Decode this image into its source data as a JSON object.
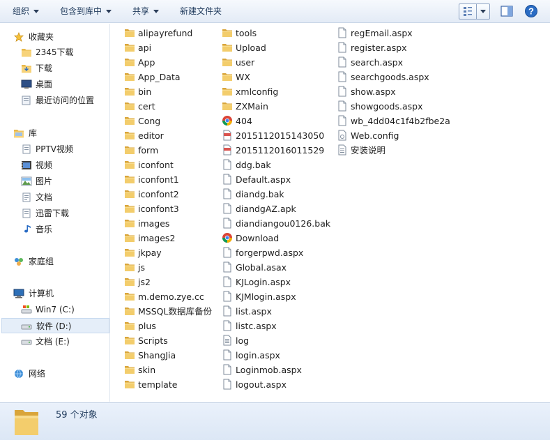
{
  "toolbar": {
    "organize": "组织",
    "include_in_library": "包含到库中",
    "share": "共享",
    "new_folder": "新建文件夹"
  },
  "nav": {
    "favorites": "收藏夹",
    "fav_2345": "2345下载",
    "fav_downloads": "下载",
    "fav_desktop": "桌面",
    "fav_recent": "最近访问的位置",
    "libraries": "库",
    "lib_pptv": "PPTV视频",
    "lib_videos": "视频",
    "lib_pictures": "图片",
    "lib_documents": "文档",
    "lib_xunlei": "迅雷下载",
    "lib_music": "音乐",
    "homegroup": "家庭组",
    "computer": "计算机",
    "drive_c": "Win7 (C:)",
    "drive_d": "软件 (D:)",
    "drive_e": "文档 (E:)",
    "network": "网络"
  },
  "files": [
    {
      "name": "alipayrefund",
      "type": "folder"
    },
    {
      "name": "api",
      "type": "folder"
    },
    {
      "name": "App",
      "type": "folder"
    },
    {
      "name": "App_Data",
      "type": "folder"
    },
    {
      "name": "bin",
      "type": "folder"
    },
    {
      "name": "cert",
      "type": "folder"
    },
    {
      "name": "Cong",
      "type": "folder"
    },
    {
      "name": "editor",
      "type": "folder"
    },
    {
      "name": "form",
      "type": "folder"
    },
    {
      "name": "iconfont",
      "type": "folder"
    },
    {
      "name": "iconfont1",
      "type": "folder"
    },
    {
      "name": "iconfont2",
      "type": "folder"
    },
    {
      "name": "iconfont3",
      "type": "folder"
    },
    {
      "name": "images",
      "type": "folder"
    },
    {
      "name": "images2",
      "type": "folder"
    },
    {
      "name": "jkpay",
      "type": "folder"
    },
    {
      "name": "js",
      "type": "folder"
    },
    {
      "name": "js2",
      "type": "folder"
    },
    {
      "name": "m.demo.zye.cc",
      "type": "folder"
    },
    {
      "name": "MSSQL数据库备份",
      "type": "folder"
    },
    {
      "name": "plus",
      "type": "folder"
    },
    {
      "name": "Scripts",
      "type": "folder"
    },
    {
      "name": "ShangJia",
      "type": "folder"
    },
    {
      "name": "skin",
      "type": "folder"
    },
    {
      "name": "template",
      "type": "folder"
    },
    {
      "name": "tools",
      "type": "folder"
    },
    {
      "name": "Upload",
      "type": "folder"
    },
    {
      "name": "user",
      "type": "folder"
    },
    {
      "name": "WX",
      "type": "folder"
    },
    {
      "name": "xmlconfig",
      "type": "folder"
    },
    {
      "name": "ZXMain",
      "type": "folder"
    },
    {
      "name": "404",
      "type": "chrome"
    },
    {
      "name": "2015112015143050",
      "type": "archive"
    },
    {
      "name": "2015112016011529",
      "type": "archive"
    },
    {
      "name": "ddg.bak",
      "type": "file"
    },
    {
      "name": "Default.aspx",
      "type": "file"
    },
    {
      "name": "diandg.bak",
      "type": "file"
    },
    {
      "name": "diandgAZ.apk",
      "type": "file"
    },
    {
      "name": "diandiangou0126.bak",
      "type": "file"
    },
    {
      "name": "Download",
      "type": "chrome"
    },
    {
      "name": "forgerpwd.aspx",
      "type": "file"
    },
    {
      "name": "Global.asax",
      "type": "file"
    },
    {
      "name": "KJLogin.aspx",
      "type": "file"
    },
    {
      "name": "KJMlogin.aspx",
      "type": "file"
    },
    {
      "name": "list.aspx",
      "type": "file"
    },
    {
      "name": "listc.aspx",
      "type": "file"
    },
    {
      "name": "log",
      "type": "textdoc"
    },
    {
      "name": "login.aspx",
      "type": "file"
    },
    {
      "name": "Loginmob.aspx",
      "type": "file"
    },
    {
      "name": "logout.aspx",
      "type": "file"
    },
    {
      "name": "regEmail.aspx",
      "type": "file"
    },
    {
      "name": "register.aspx",
      "type": "file"
    },
    {
      "name": "search.aspx",
      "type": "file"
    },
    {
      "name": "searchgoods.aspx",
      "type": "file"
    },
    {
      "name": "show.aspx",
      "type": "file"
    },
    {
      "name": "showgoods.aspx",
      "type": "file"
    },
    {
      "name": "wb_4dd04c1f4b2fbe2a",
      "type": "file"
    },
    {
      "name": "Web.config",
      "type": "config"
    },
    {
      "name": "安装说明",
      "type": "textdoc"
    }
  ],
  "status": {
    "count_text": "59 个对象"
  }
}
